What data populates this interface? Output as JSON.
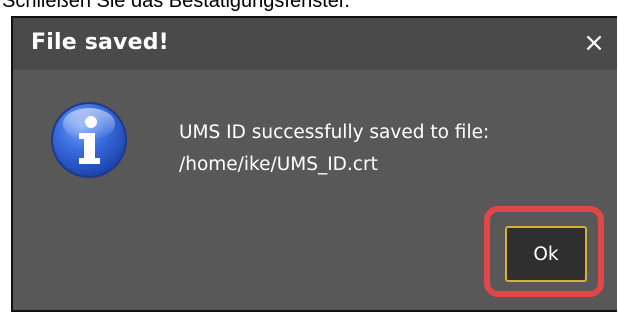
{
  "caption": {
    "text": "Schließen Sie das Bestätigungsfenster."
  },
  "dialog": {
    "title": "File saved!",
    "close_glyph": "×",
    "icon": "info-icon",
    "message_line1": "UMS ID successfully saved to file:",
    "message_line2": "/home/ike/UMS_ID.crt",
    "ok_label": "Ok"
  },
  "colors": {
    "dialog_background": "#585858",
    "titlebar_background": "#4a4a4a",
    "button_background": "#2f2f2f",
    "button_focus_border": "#d7b03c",
    "highlight": "#e24646",
    "info_icon_blue": "#2a56c6"
  }
}
